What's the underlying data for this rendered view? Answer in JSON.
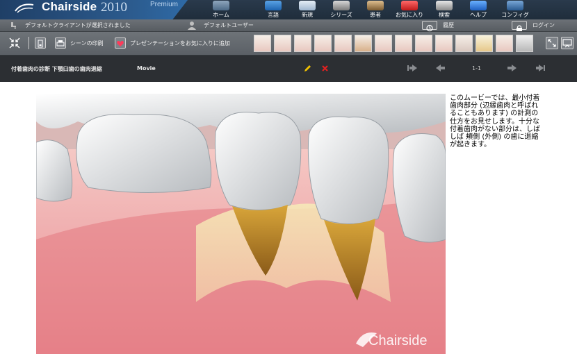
{
  "window": {
    "brand": "Chairside",
    "year": "2010",
    "edition": "Premium"
  },
  "nav": [
    {
      "label": "ホーム",
      "icon": "house-icon"
    },
    {
      "label": "言語",
      "icon": "language-icon"
    },
    {
      "label": "新規",
      "icon": "new-document-icon"
    },
    {
      "label": "シリーズ",
      "icon": "film-icon"
    },
    {
      "label": "患者",
      "icon": "patient-icon"
    },
    {
      "label": "お気に入り",
      "icon": "heart-icon"
    },
    {
      "label": "検索",
      "icon": "search-icon"
    },
    {
      "label": "ヘルプ",
      "icon": "help-icon"
    },
    {
      "label": "コンフィグ",
      "icon": "gear-icon"
    }
  ],
  "status": {
    "client": "デフォルトクライアントが選択されました",
    "user": "デフォルトユーザー",
    "history": "履歴",
    "login": "ログイン"
  },
  "toolbar": {
    "print_scene": "シーンの印刷",
    "add_favorite": "プレゼンテーションをお気に入りに追加"
  },
  "titlebar": {
    "title": "付着歯肉の診断  下顎臼歯の歯肉退縮",
    "media_type": "Movie",
    "page": "1-1"
  },
  "video": {
    "watermark": "Chairside"
  },
  "description": {
    "text": "このムービーでは、最小付着歯肉部分 (辺縁歯肉と呼ばれることもあります) の計測の仕方をお見せします。十分な付着歯肉がない部分は、しばしば 頬側 (外側) の歯に退縮が起きます。"
  },
  "colors": {
    "header_bg": "#1f2d3b",
    "brand_blue": "#2c5b8e",
    "toolbar_bg": "#5b6066",
    "titlebar_bg": "#2c2f33",
    "edit_pencil": "#f2c200",
    "delete_x": "#e02020"
  }
}
